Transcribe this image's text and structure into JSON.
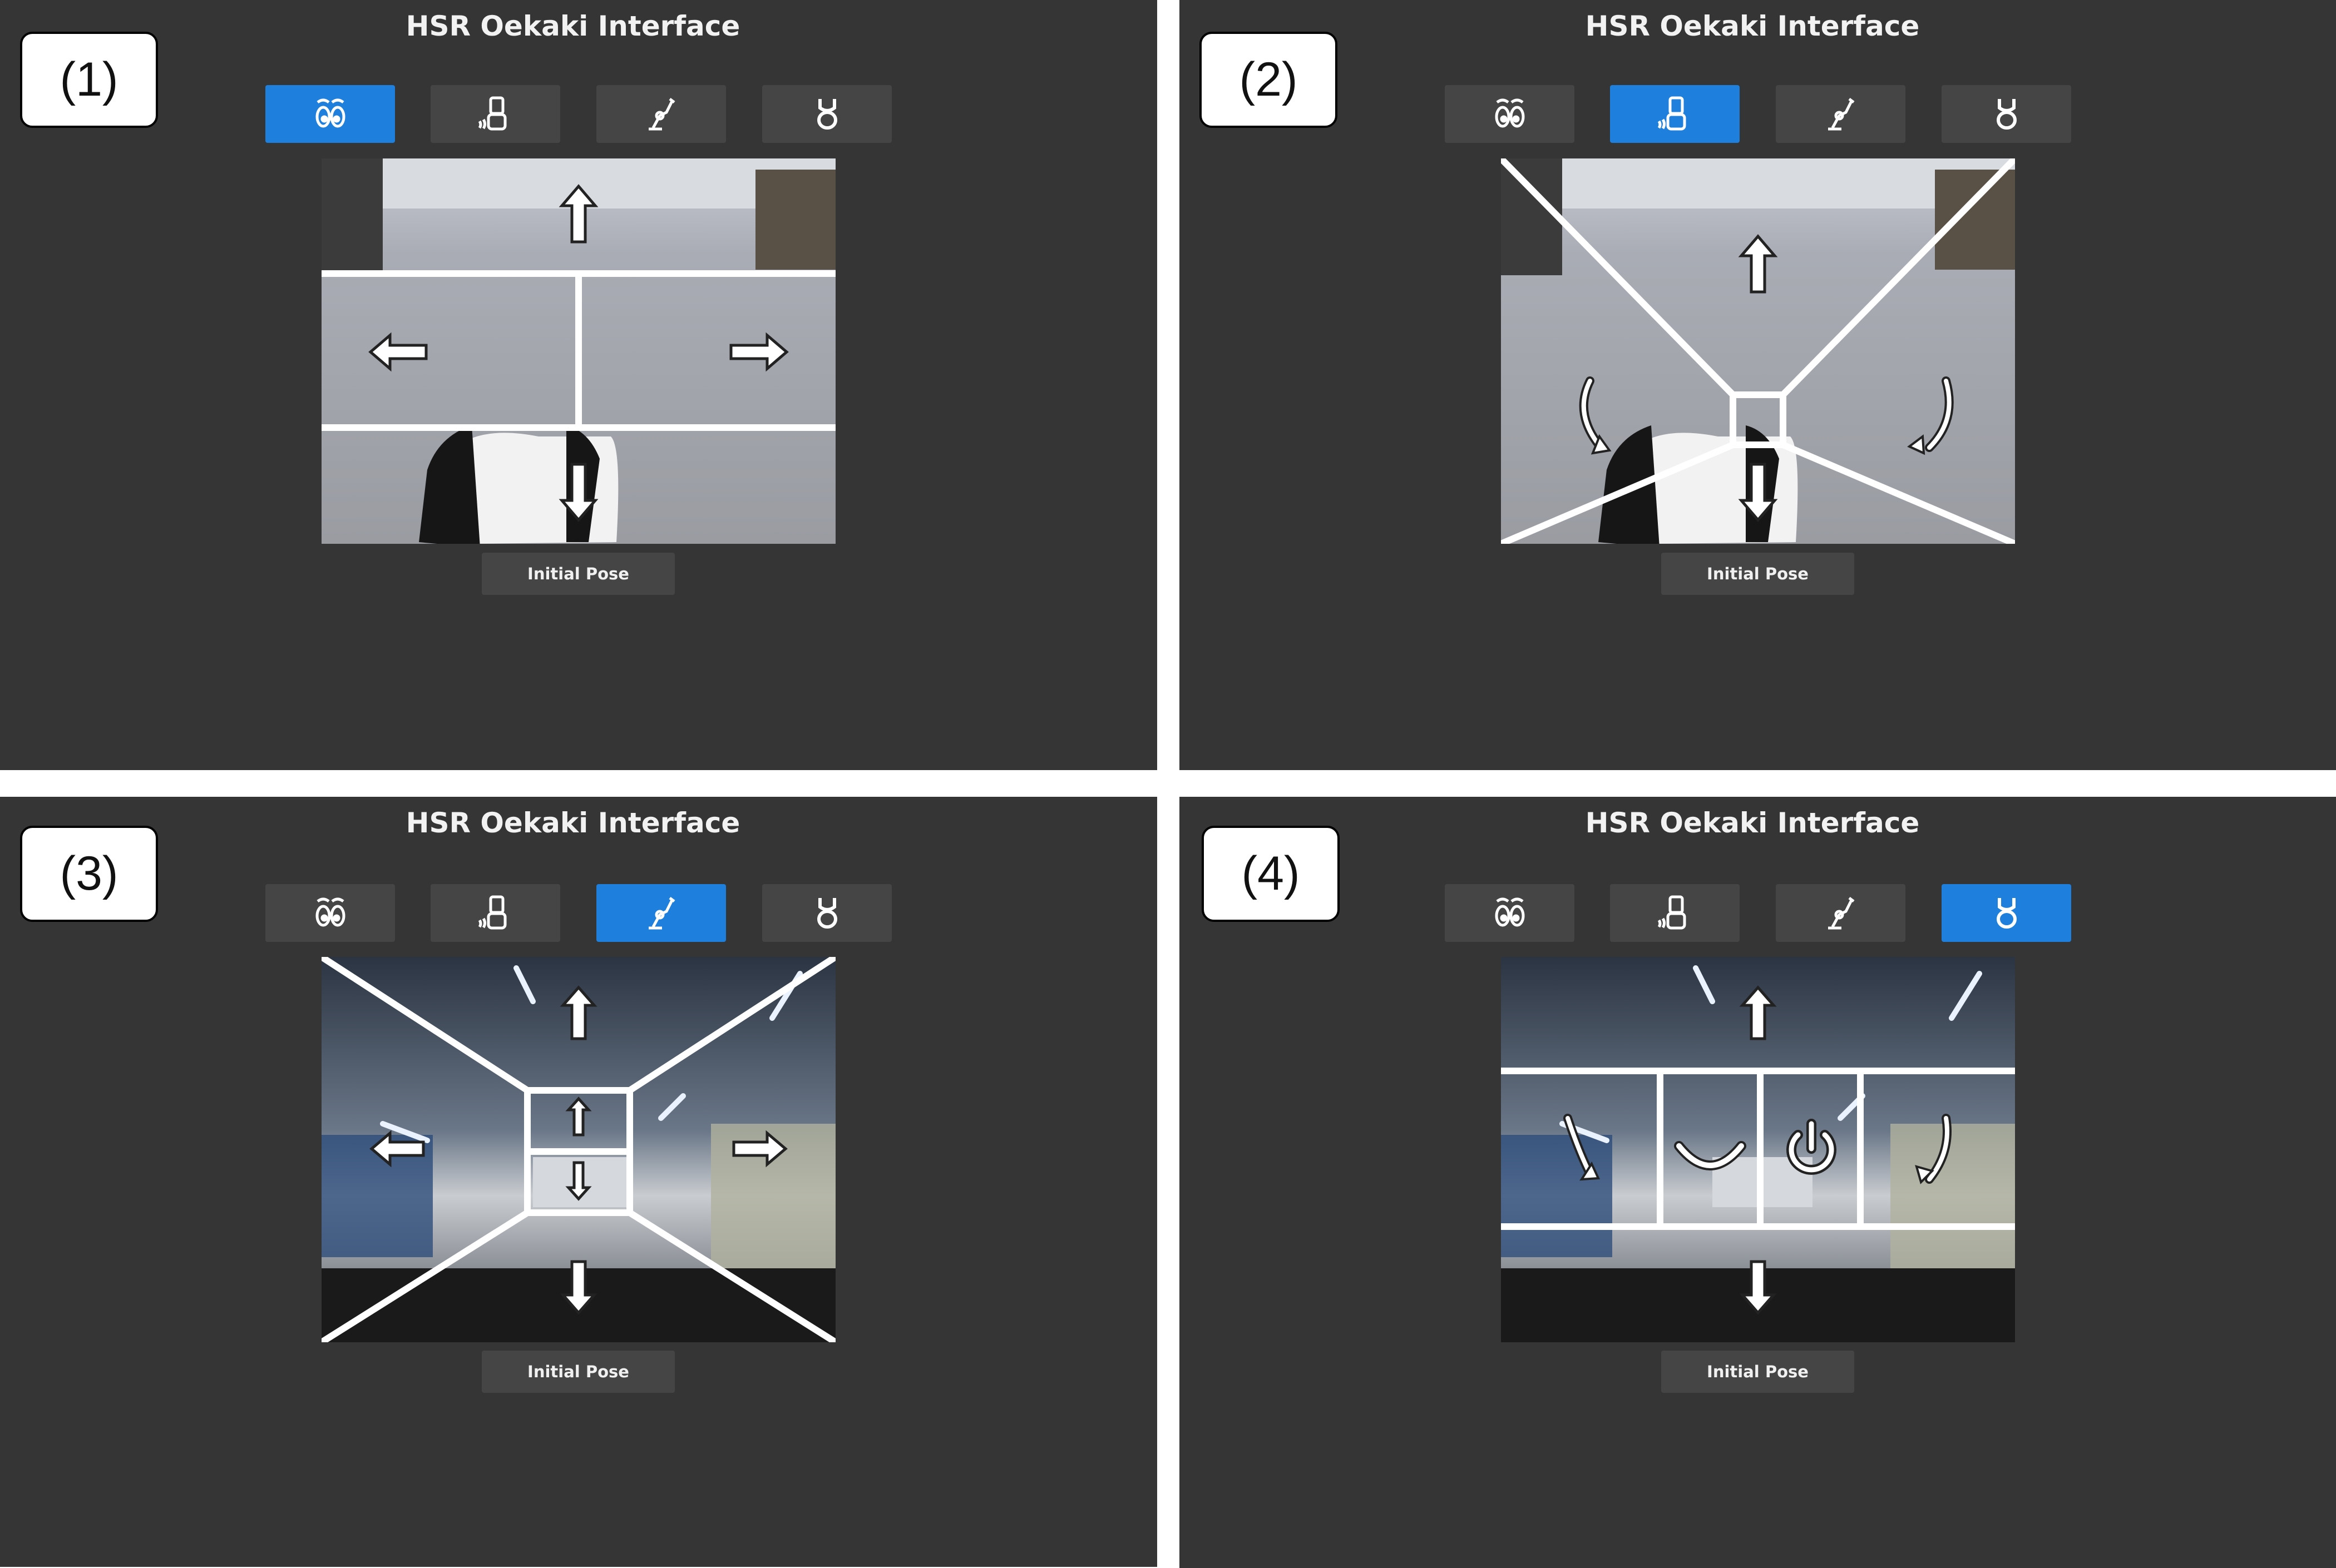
{
  "colors": {
    "panel_bg": "#353535",
    "button_bg": "#454545",
    "active": "#1e7fdc",
    "overlay": "#ffffff"
  },
  "panels": [
    {
      "label": "(1)",
      "title": "HSR Oekaki Interface",
      "active_mode": "eyes",
      "reset_label": "Initial Pose",
      "camera_view": "floor"
    },
    {
      "label": "(2)",
      "title": "HSR Oekaki Interface",
      "active_mode": "base",
      "reset_label": "Initial Pose",
      "camera_view": "floor"
    },
    {
      "label": "(3)",
      "title": "HSR Oekaki Interface",
      "active_mode": "arm",
      "reset_label": "Initial Pose",
      "camera_view": "ceiling"
    },
    {
      "label": "(4)",
      "title": "HSR Oekaki Interface",
      "active_mode": "gripper",
      "reset_label": "Initial Pose",
      "camera_view": "ceiling"
    }
  ],
  "modes": [
    {
      "name": "eyes",
      "icon": "eyes-icon"
    },
    {
      "name": "base",
      "icon": "robot-base-icon"
    },
    {
      "name": "arm",
      "icon": "robot-arm-icon"
    },
    {
      "name": "gripper",
      "icon": "gripper-icon"
    }
  ]
}
